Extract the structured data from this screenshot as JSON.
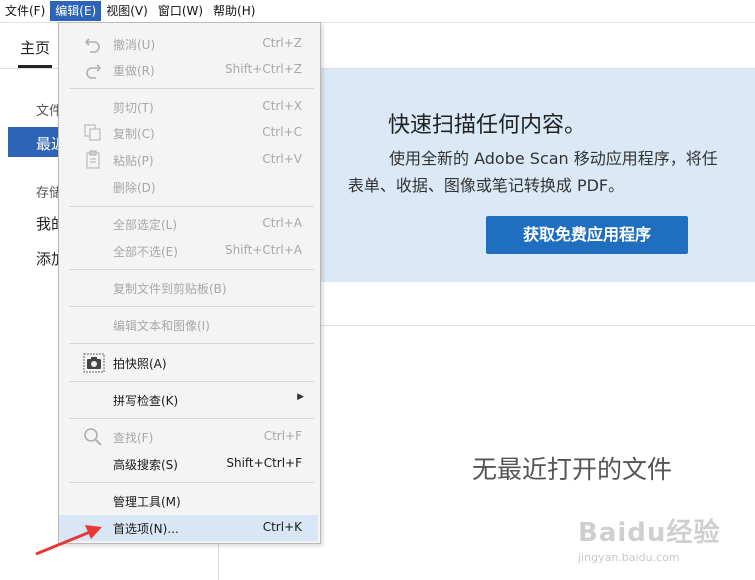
{
  "menubar": {
    "items": [
      {
        "label": "文件(F)"
      },
      {
        "label": "编辑(E)"
      },
      {
        "label": "视图(V)"
      },
      {
        "label": "窗口(W)"
      },
      {
        "label": "帮助(H)"
      }
    ]
  },
  "tabs": {
    "home": "主页"
  },
  "sidebar": {
    "section_files": "文件",
    "recent": "最近",
    "section_storage": "存储",
    "my": "我的",
    "add": "添加"
  },
  "promo": {
    "title": "快速扫描任何内容。",
    "line1": "使用全新的 Adobe Scan 移动应用程序，将任",
    "line2": "表单、收据、图像或笔记转换成 PDF。",
    "button": "获取免费应用程序"
  },
  "main": {
    "empty_text": "无最近打开的文件"
  },
  "edit_menu": {
    "undo": {
      "label": "撤消(U)",
      "shortcut": "Ctrl+Z"
    },
    "redo": {
      "label": "重做(R)",
      "shortcut": "Shift+Ctrl+Z"
    },
    "cut": {
      "label": "剪切(T)",
      "shortcut": "Ctrl+X"
    },
    "copy": {
      "label": "复制(C)",
      "shortcut": "Ctrl+C"
    },
    "paste": {
      "label": "粘贴(P)",
      "shortcut": "Ctrl+V"
    },
    "delete": {
      "label": "删除(D)"
    },
    "select_all": {
      "label": "全部选定(L)",
      "shortcut": "Ctrl+A"
    },
    "deselect_all": {
      "label": "全部不选(E)",
      "shortcut": "Shift+Ctrl+A"
    },
    "copy_file": {
      "label": "复制文件到剪贴板(B)"
    },
    "edit_text": {
      "label": "编辑文本和图像(I)"
    },
    "snapshot": {
      "label": "拍快照(A)"
    },
    "spell_check": {
      "label": "拼写检查(K)"
    },
    "find": {
      "label": "查找(F)",
      "shortcut": "Ctrl+F"
    },
    "advanced_search": {
      "label": "高级搜索(S)",
      "shortcut": "Shift+Ctrl+F"
    },
    "manage_tools": {
      "label": "管理工具(M)"
    },
    "preferences": {
      "label": "首选项(N)...",
      "shortcut": "Ctrl+K"
    }
  },
  "watermark": {
    "brand": "Baidu经验",
    "url": "jingyan.baidu.com"
  },
  "icons": {
    "undo": "undo-icon",
    "redo": "redo-icon",
    "copy": "copy-icon",
    "paste": "paste-icon",
    "camera": "camera-icon",
    "search": "search-icon",
    "submenu": "chevron-right-icon",
    "annotation": "red-arrow-icon"
  },
  "colors": {
    "accent": "#2e64b5",
    "promo_bg": "#dbe9f6",
    "button": "#1f6ec0",
    "annotation": "#e53935"
  }
}
